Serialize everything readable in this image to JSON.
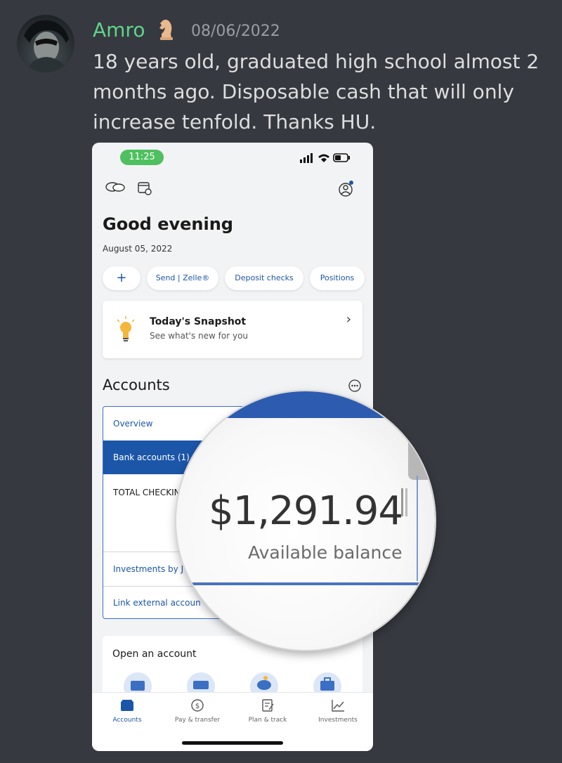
{
  "discord": {
    "username": "Amro",
    "timestamp": "08/06/2022",
    "message": "18 years old, graduated high school almost 2 months ago. Disposable cash that will only increase tenfold. Thanks HU.",
    "username_color": "#5fd48a"
  },
  "phone": {
    "status_time": "11:25",
    "greeting": "Good evening",
    "date": "August 05, 2022",
    "quick_actions": [
      "+",
      "Send | Zelle®",
      "Deposit checks",
      "Positions"
    ],
    "snapshot": {
      "title": "Today's Snapshot",
      "subtitle": "See what's new for you"
    },
    "accounts_heading": "Accounts",
    "account_rows": {
      "overview": "Overview",
      "bank_accounts": "Bank accounts (1)",
      "total_checking": "TOTAL CHECKIN",
      "investments": "Investments by J",
      "link_external": "Link external accoun"
    },
    "open_account_title": "Open an account",
    "tabs": [
      "Accounts",
      "Pay & transfer",
      "Plan & track",
      "Investments"
    ],
    "brand_color": "#1c56a8"
  },
  "magnifier": {
    "amount": "$1,291.94",
    "label": "Available balance"
  }
}
